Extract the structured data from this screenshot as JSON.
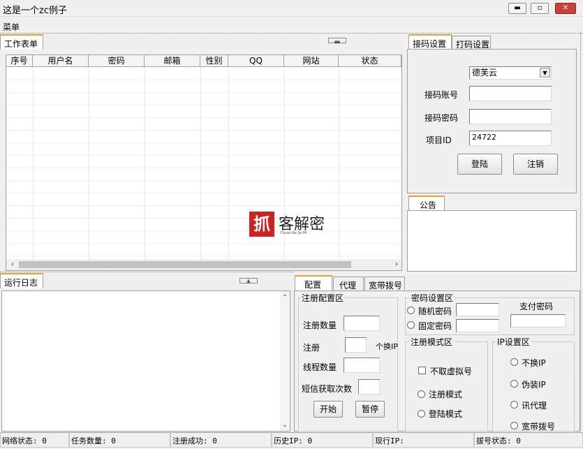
{
  "window": {
    "title": "这是一个zc例子"
  },
  "menu": {
    "item": "菜单"
  },
  "worksheet": {
    "tab": "工作表单",
    "columns": [
      "序号",
      "用户名",
      "密码",
      "邮箱",
      "性别",
      "QQ",
      "网站",
      "状态"
    ]
  },
  "watermark": {
    "text": "客解密",
    "small": "Chuan Ke Jie Mi"
  },
  "receive_settings": {
    "tabs": [
      "接码设置",
      "打码设置"
    ],
    "platform": "德芙云",
    "account_label": "接码账号",
    "account_value": "",
    "password_label": "接码密码",
    "password_value": "",
    "project_label": "项目ID",
    "project_value": "24722",
    "login_button": "登陆",
    "logout_button": "注销"
  },
  "notice": {
    "tab": "公告"
  },
  "log": {
    "tab": "运行日志"
  },
  "config": {
    "tabs": [
      "配置",
      "代理",
      "宽带拨号"
    ],
    "register_area": {
      "title": "注册配置区",
      "count_label": "注册数量",
      "count_value": "",
      "register_label": "注册",
      "switch_ip_label": "个换IP",
      "switch_value": "",
      "threads_label": "线程数量",
      "threads_value": "",
      "sms_label": "短信获取次数",
      "sms_value": "",
      "start_button": "开始",
      "pause_button": "暂停"
    },
    "password_area": {
      "title": "密码设置区",
      "random_label": "随机密码",
      "fixed_label": "固定密码",
      "pay_label": "支付密码"
    },
    "mode_area": {
      "title": "注册模式区",
      "no_virtual_label": "不取虚拟号",
      "register_mode_label": "注册模式",
      "login_mode_label": "登陆模式"
    },
    "ip_area": {
      "title": "IP设置区",
      "options": [
        "不换IP",
        "伪装IP",
        "讯代理",
        "宽带拨号"
      ]
    }
  },
  "status_bar": [
    "网络状态: 0",
    "任务数量: 0",
    "注册成功: 0",
    "历史IP: 0",
    "现行IP:",
    "拔号状态: 0"
  ],
  "colors": {
    "tab_accent": "#f0a030",
    "close_button": "#c8423a",
    "watermark_red": "#d02020"
  }
}
